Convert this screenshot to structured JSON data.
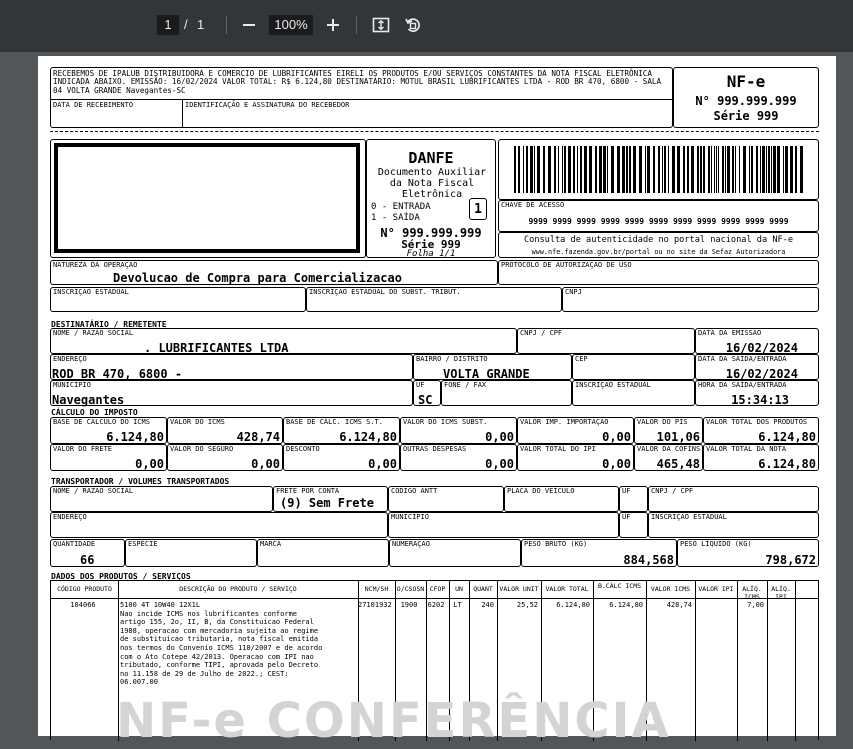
{
  "viewer": {
    "current_page": "1",
    "page_separator": "/",
    "total_pages": "1",
    "zoom_level": "100%",
    "icons": [
      "zoom-out-icon",
      "zoom-in-icon",
      "fit-page-icon",
      "rotate-icon"
    ]
  },
  "canhoto": {
    "text": "RECEBEMOS DE IPALUB DISTRIBUIDORA E COMERCIO DE LUBRIFICANTES EIRELI OS PRODUTOS E/OU SERVIÇOS CONSTANTES DA NOTA FISCAL ELETRÔNICA INDICADA ABAIXO. EMISSÃO: 16/02/2024 VALOR TOTAL: R$ 6.124,80 DESTINATÁRIO: MOTUL BRASIL LUBRIFICANTES LTDA - ROD BR 470, 6800 - SALA 04 VOLTA GRANDE Navegantes-SC",
    "data_recebimento_label": "DATA DE RECEBIMENTO",
    "assinatura_label": "IDENTIFICAÇÃO E ASSINATURA DO RECEBEDOR",
    "nfe_title": "NF-e",
    "nfe_number": "N° 999.999.999",
    "nfe_serie": "Série 999"
  },
  "danfe": {
    "title": "DANFE",
    "subtitle": "Documento Auxiliar da Nota Fiscal Eletrônica",
    "entrada": "0 - ENTRADA",
    "saida": "1 - SAÍDA",
    "tipo": "1",
    "number": "N° 999.999.999",
    "serie": "Série 999",
    "folha": "Folha 1/1",
    "chave_label": "CHAVE DE ACESSO",
    "chave": "9999 9999 9999 9999 9999 9999 9999 9999 9999 9999 9999",
    "consulta": "Consulta de autenticidade no portal nacional da NF-e",
    "consulta_site": "www.nfe.fazenda.gov.br/portal ou no site da Sefaz Autorizadora"
  },
  "header_fields": {
    "natureza_label": "NATUREZA DA OPERAÇÃO",
    "natureza": "Devolucao de Compra para Comercializacao",
    "protocolo_label": "PROTOCOLO DE AUTORIZAÇÃO DE USO",
    "ie_label": "INSCRIÇÃO ESTADUAL",
    "ie_st_label": "INSCRIÇÃO ESTADUAL DO SUBST. TRIBUT.",
    "cnpj_label": "CNPJ"
  },
  "destinatario": {
    "section": "DESTINATÁRIO / REMETENTE",
    "nome_label": "NOME / RAZÃO SOCIAL",
    "nome": ". LUBRIFICANTES LTDA",
    "cnpj_label": "CNPJ / CPF",
    "emissao_label": "DATA DA EMISSÃO",
    "emissao": "16/02/2024",
    "endereco_label": "ENDEREÇO",
    "endereco": "ROD BR 470, 6800 -",
    "bairro_label": "BAIRRO / DISTRITO",
    "bairro": "VOLTA GRANDE",
    "cep_label": "CEP",
    "saida_label": "DATA DA SAÍDA/ENTRADA",
    "saida": "16/02/2024",
    "municipio_label": "MUNICÍPIO",
    "municipio": "Navegantes",
    "uf_label": "UF",
    "uf": "SC",
    "fone_label": "FONE / FAX",
    "ie_label": "INSCRIÇÃO ESTADUAL",
    "hora_label": "HORA DA SAÍDA/ENTRADA",
    "hora": "15:34:13"
  },
  "imposto": {
    "section": "CÁLCULO DO IMPOSTO",
    "row1": [
      {
        "label": "BASE DE CÁLCULO DO ICMS",
        "value": "6.124,80"
      },
      {
        "label": "VALOR DO ICMS",
        "value": "428,74"
      },
      {
        "label": "BASE DE CÁLC. ICMS S.T.",
        "value": "6.124,80"
      },
      {
        "label": "VALOR DO ICMS SUBST.",
        "value": "0,00"
      },
      {
        "label": "VALOR IMP. IMPORTAÇÃO",
        "value": "0,00"
      },
      {
        "label": "VALOR DO PIS",
        "value": "101,06"
      },
      {
        "label": "VALOR TOTAL DOS PRODUTOS",
        "value": "6.124,80"
      }
    ],
    "row2": [
      {
        "label": "VALOR DO FRETE",
        "value": "0,00"
      },
      {
        "label": "VALOR DO SEGURO",
        "value": "0,00"
      },
      {
        "label": "DESCONTO",
        "value": "0,00"
      },
      {
        "label": "OUTRAS DESPESAS",
        "value": "0,00"
      },
      {
        "label": "VALOR TOTAL DO IPI",
        "value": "0,00"
      },
      {
        "label": "VALOR DA COFINS",
        "value": "465,48"
      },
      {
        "label": "VALOR TOTAL DA NOTA",
        "value": "6.124,80"
      }
    ]
  },
  "transportador": {
    "section": "TRANSPORTADOR / VOLUMES TRANSPORTADOS",
    "nome_label": "NOME / RAZÃO SOCIAL",
    "frete_label": "FRETE POR CONTA",
    "frete": "(9) Sem Frete",
    "antt_label": "CÓDIGO ANTT",
    "placa_label": "PLACA DO VEÍCULO",
    "uf_label": "UF",
    "cnpj_label": "CNPJ / CPF",
    "endereco_label": "ENDEREÇO",
    "municipio_label": "MUNICÍPIO",
    "uf2_label": "UF",
    "ie_label": "INSCRIÇÃO ESTADUAL",
    "quantidade_label": "QUANTIDADE",
    "quantidade": "66",
    "especie_label": "ESPÉCIE",
    "marca_label": "MARCA",
    "numeracao_label": "NUMERAÇÃO",
    "peso_bruto_label": "PESO BRUTO (KG)",
    "peso_bruto": "884,568",
    "peso_liquido_label": "PESO LÍQUIDO (KG)",
    "peso_liquido": "798,672"
  },
  "produtos": {
    "section": "DADOS DOS PRODUTOS / SERVIÇOS",
    "headers": [
      "CÓDIGO PRODUTO",
      "DESCRIÇÃO DO PRODUTO / SERVIÇO",
      "NCM/SH",
      "O/CSOSN",
      "CFOP",
      "UN",
      "QUANT",
      "VALOR UNIT",
      "VALOR TOTAL",
      "B.CÁLC ICMS",
      "VALOR ICMS",
      "VALOR IPI",
      "ALÍQ. ICMS",
      "ALÍQ. IPI"
    ],
    "item": {
      "codigo": "104066",
      "descricao": [
        "5100 4T 10W40 12X1L",
        "Nao incide ICMS nos lubrificantes conforme",
        "artigo 155, 2o, II, B, da Constituicao Federal",
        "1988, operacao com mercadoria sujeita ao regime",
        "de substituicao tributaria, nota fiscal emitida",
        "nos termos do Convenio ICMS 110/2007 e de acordo",
        "com o Ato Cotepe 42/2013. Operacao com IPI nao",
        "tributado, conforme TIPI, aprovada pelo Decreto",
        "no 11.158 de 29 de Julho de 2022.; CEST:",
        "06.007.00"
      ],
      "ncm": "27101932",
      "cst": "1900",
      "cfop": "6202",
      "un": "LT",
      "quant": "240",
      "valor_unit": "25,52",
      "valor_total": "6.124,80",
      "bc_icms": "6.124,80",
      "valor_icms": "428,74",
      "valor_ipi": "",
      "aliq_icms": "7,00",
      "aliq_ipi": ""
    }
  },
  "watermark": "NF-e CONFERÊNCIA"
}
